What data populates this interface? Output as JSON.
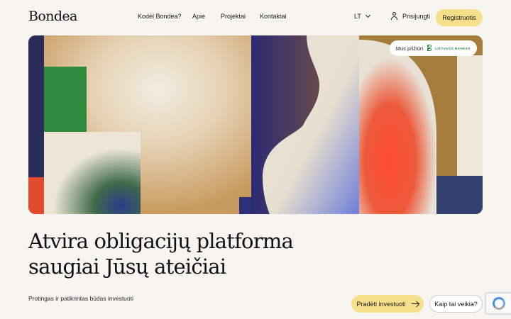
{
  "header": {
    "logo": "Bondea",
    "nav": [
      {
        "label": "Kodėl Bondea?"
      },
      {
        "label": "Apie"
      },
      {
        "label": "Projektai"
      },
      {
        "label": "Kontaktai"
      }
    ],
    "language": "LT",
    "login_label": "Prisijungti",
    "register_label": "Registruotis"
  },
  "hero": {
    "badge_label": "Mus prižiūri",
    "regulator_name": "LIETUVOS BANKAS"
  },
  "main": {
    "headline_line1": "Atvira obligacijų platforma",
    "headline_line2": "saugiai Jūsų ateičiai",
    "tagline": "Protingas ir patikrintas būdas investuoti",
    "invest_label": "Pradėti investuoti",
    "how_label": "Kaip tai veikia?"
  },
  "icons": {
    "user": "user-icon",
    "chevron": "chevron-down-icon",
    "arrow": "arrow-right-icon",
    "recaptcha": "recaptcha-icon",
    "regulator": "lietuvos-bankas-logo"
  },
  "colors": {
    "background": "#f7f5f0",
    "accent_yellow": "#f6e08c",
    "text": "#1a1a1a",
    "lb_green": "#2f8f4e"
  }
}
